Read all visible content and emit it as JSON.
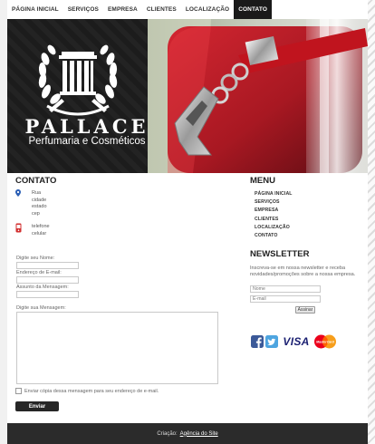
{
  "nav": {
    "items": [
      {
        "label": "PÁGINA INICIAL"
      },
      {
        "label": "SERVIÇOS"
      },
      {
        "label": "EMPRESA"
      },
      {
        "label": "CLIENTES"
      },
      {
        "label": "LOCALIZAÇÃO"
      },
      {
        "label": "CONTATO",
        "active": true
      }
    ]
  },
  "banner": {
    "brand_name": "PALLACE",
    "brand_tagline": "Perfumaria e Cosméticos"
  },
  "contato": {
    "heading": "CONTATO",
    "address_lines": [
      "Rua",
      "cidade",
      "estado",
      "cep"
    ],
    "phone_lines": [
      "telefone",
      "celular"
    ],
    "form": {
      "name_label": "Digite seu Nome:",
      "email_label": "Endereço de E-mail:",
      "subject_label": "Assunto da Mensagem:",
      "message_label": "Digite sua Mensagem:",
      "copy_label": "Enviar cópia dessa mensagem para seu endereço de e-mail.",
      "submit_label": "Enviar"
    }
  },
  "menu": {
    "heading": "MENU",
    "items": [
      "PÁGINA INICIAL",
      "SERVIÇOS",
      "EMPRESA",
      "CLIENTES",
      "LOCALIZAÇÃO",
      "CONTATO"
    ]
  },
  "newsletter": {
    "heading": "NEWSLETTER",
    "text": "Inscreva-se em nossa newsletter e receba novidades/promoções sobre a nossa empresa.",
    "name_placeholder": "Nome",
    "email_placeholder": "E-mail",
    "subscribe_label": "Assinar"
  },
  "badges": {
    "visa": "VISA",
    "mastercard": "MasterCard"
  },
  "footer": {
    "prefix": "Criação:",
    "link": "Agência do Site"
  },
  "colors": {
    "nav_active_bg": "#1a1a1a",
    "banner_red": "#a81822",
    "footer_bg": "#2b2b2b",
    "facebook": "#3b5998",
    "twitter": "#4ea5e0",
    "visa": "#1a1f71"
  }
}
